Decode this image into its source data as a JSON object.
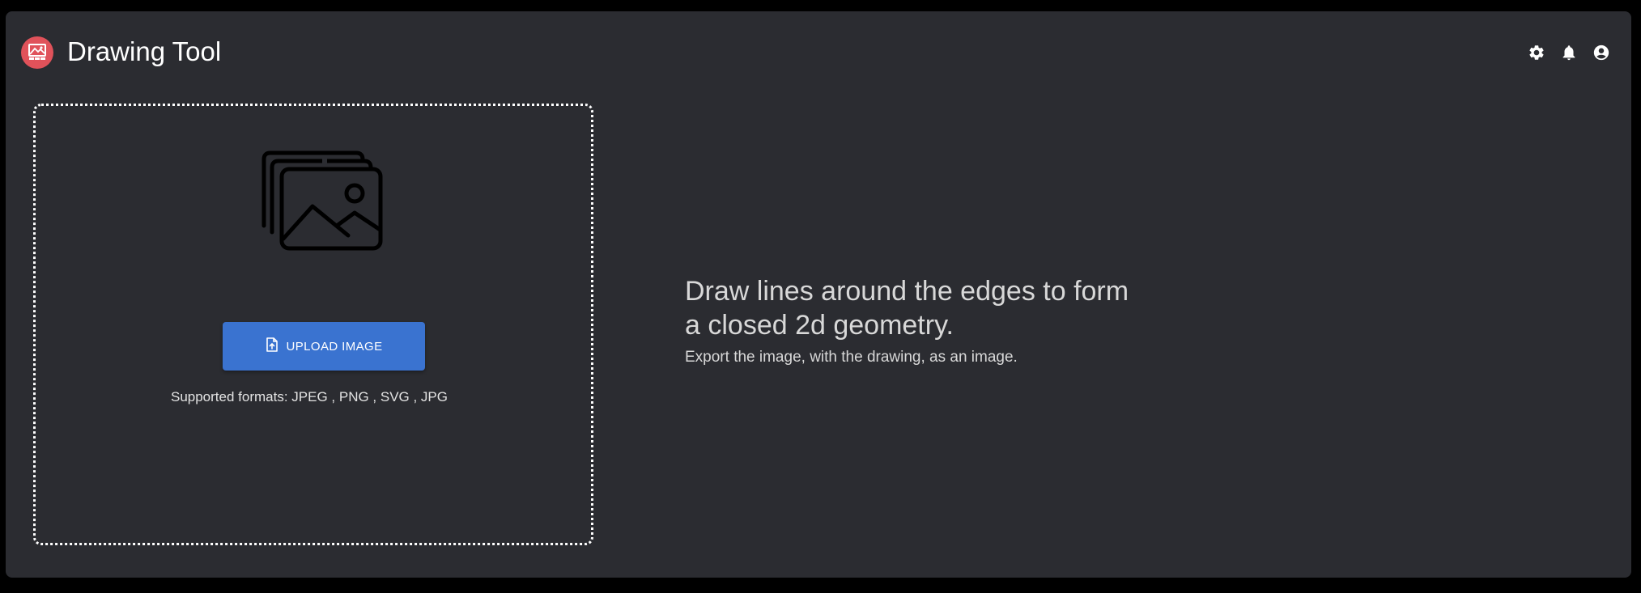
{
  "header": {
    "app_title": "Drawing Tool",
    "logo_icon": "drawing-image-icon",
    "logo_color": "#e0525a",
    "actions": [
      {
        "name": "settings-gear-icon"
      },
      {
        "name": "notifications-bell-icon"
      },
      {
        "name": "account-circle-icon"
      }
    ]
  },
  "dropzone": {
    "illustration_icon": "image-stack-icon",
    "upload_button": {
      "label": "UPLOAD IMAGE",
      "icon": "file-upload-icon",
      "color": "#3a73d0"
    },
    "supported_formats": "Supported formats: JPEG , PNG , SVG , JPG"
  },
  "info": {
    "heading": "Draw lines around the edges to form a closed 2d geometry.",
    "subtext": "Export the image, with the drawing, as an image."
  },
  "colors": {
    "background": "#000000",
    "panel": "#2b2c31",
    "text": "#ffffff"
  }
}
